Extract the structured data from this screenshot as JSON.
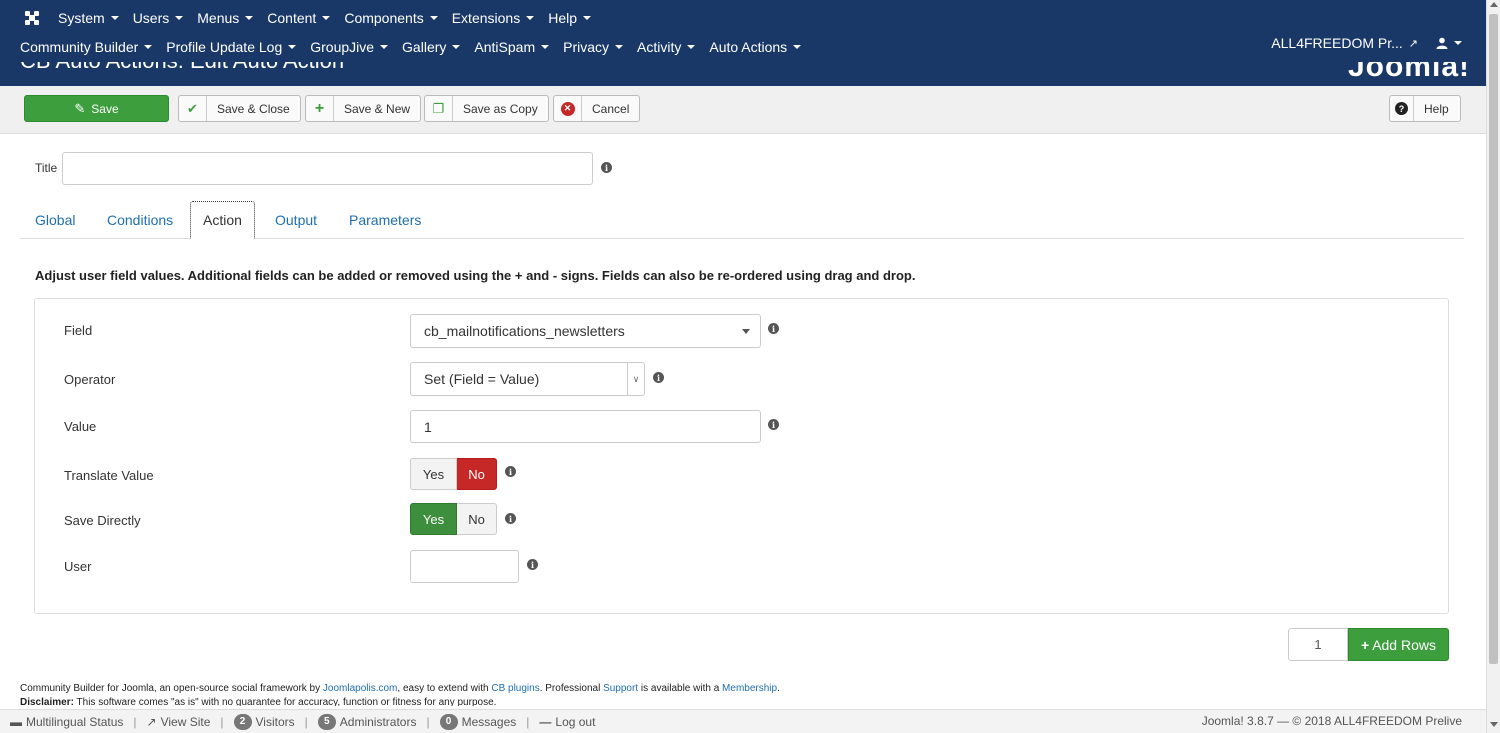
{
  "nav": {
    "row1": [
      "System",
      "Users",
      "Menus",
      "Content",
      "Components",
      "Extensions",
      "Help"
    ],
    "row2": [
      "Community Builder",
      "Profile Update Log",
      "GroupJive",
      "Gallery",
      "AntiSpam",
      "Privacy",
      "Activity",
      "Auto Actions"
    ],
    "site_name": "ALL4FREEDOM Pr...",
    "page_title": "CB Auto Actions: Edit Auto Action",
    "brand": "Joomla!"
  },
  "toolbar": {
    "save": "Save",
    "save_close": "Save & Close",
    "save_new": "Save & New",
    "save_copy": "Save as Copy",
    "cancel": "Cancel",
    "help": "Help"
  },
  "form": {
    "title_label": "Title",
    "title_value": ""
  },
  "tabs": [
    "Global",
    "Conditions",
    "Action",
    "Output",
    "Parameters"
  ],
  "description": "Adjust user field values. Additional fields can be added or removed using the + and - signs. Fields can also be re-ordered using drag and drop.",
  "action": {
    "field_label": "Field",
    "field_value": "cb_mailnotifications_newsletters",
    "operator_label": "Operator",
    "operator_value": "Set (Field = Value)",
    "value_label": "Value",
    "value_value": "1",
    "translate_label": "Translate Value",
    "save_directly_label": "Save Directly",
    "user_label": "User",
    "user_value": "",
    "yes": "Yes",
    "no": "No"
  },
  "rows": {
    "count": "1",
    "add_label": "Add Rows"
  },
  "footer": {
    "line1_a": "Community Builder for Joomla, an open-source social framework by ",
    "joomlapolis": "Joomlapolis.com",
    "line1_b": ", easy to extend with ",
    "cb_plugins": "CB plugins",
    "line1_c": ". Professional ",
    "support": "Support",
    "line1_d": " is available with a ",
    "membership": "Membership",
    "line1_e": ".",
    "disclaimer_label": "Disclaimer:",
    "disclaimer_text": " This software comes \"as is\" with no guarantee for accuracy, function or fitness for any purpose."
  },
  "status": {
    "multilingual": "Multilingual Status",
    "view_site": "View Site",
    "visitors_count": "2",
    "visitors": "Visitors",
    "admins_count": "5",
    "admins": "Administrators",
    "messages_count": "0",
    "messages": "Messages",
    "logout": "Log out",
    "version": "Joomla! 3.8.7 — © 2018 ALL4FREEDOM Prelive"
  }
}
